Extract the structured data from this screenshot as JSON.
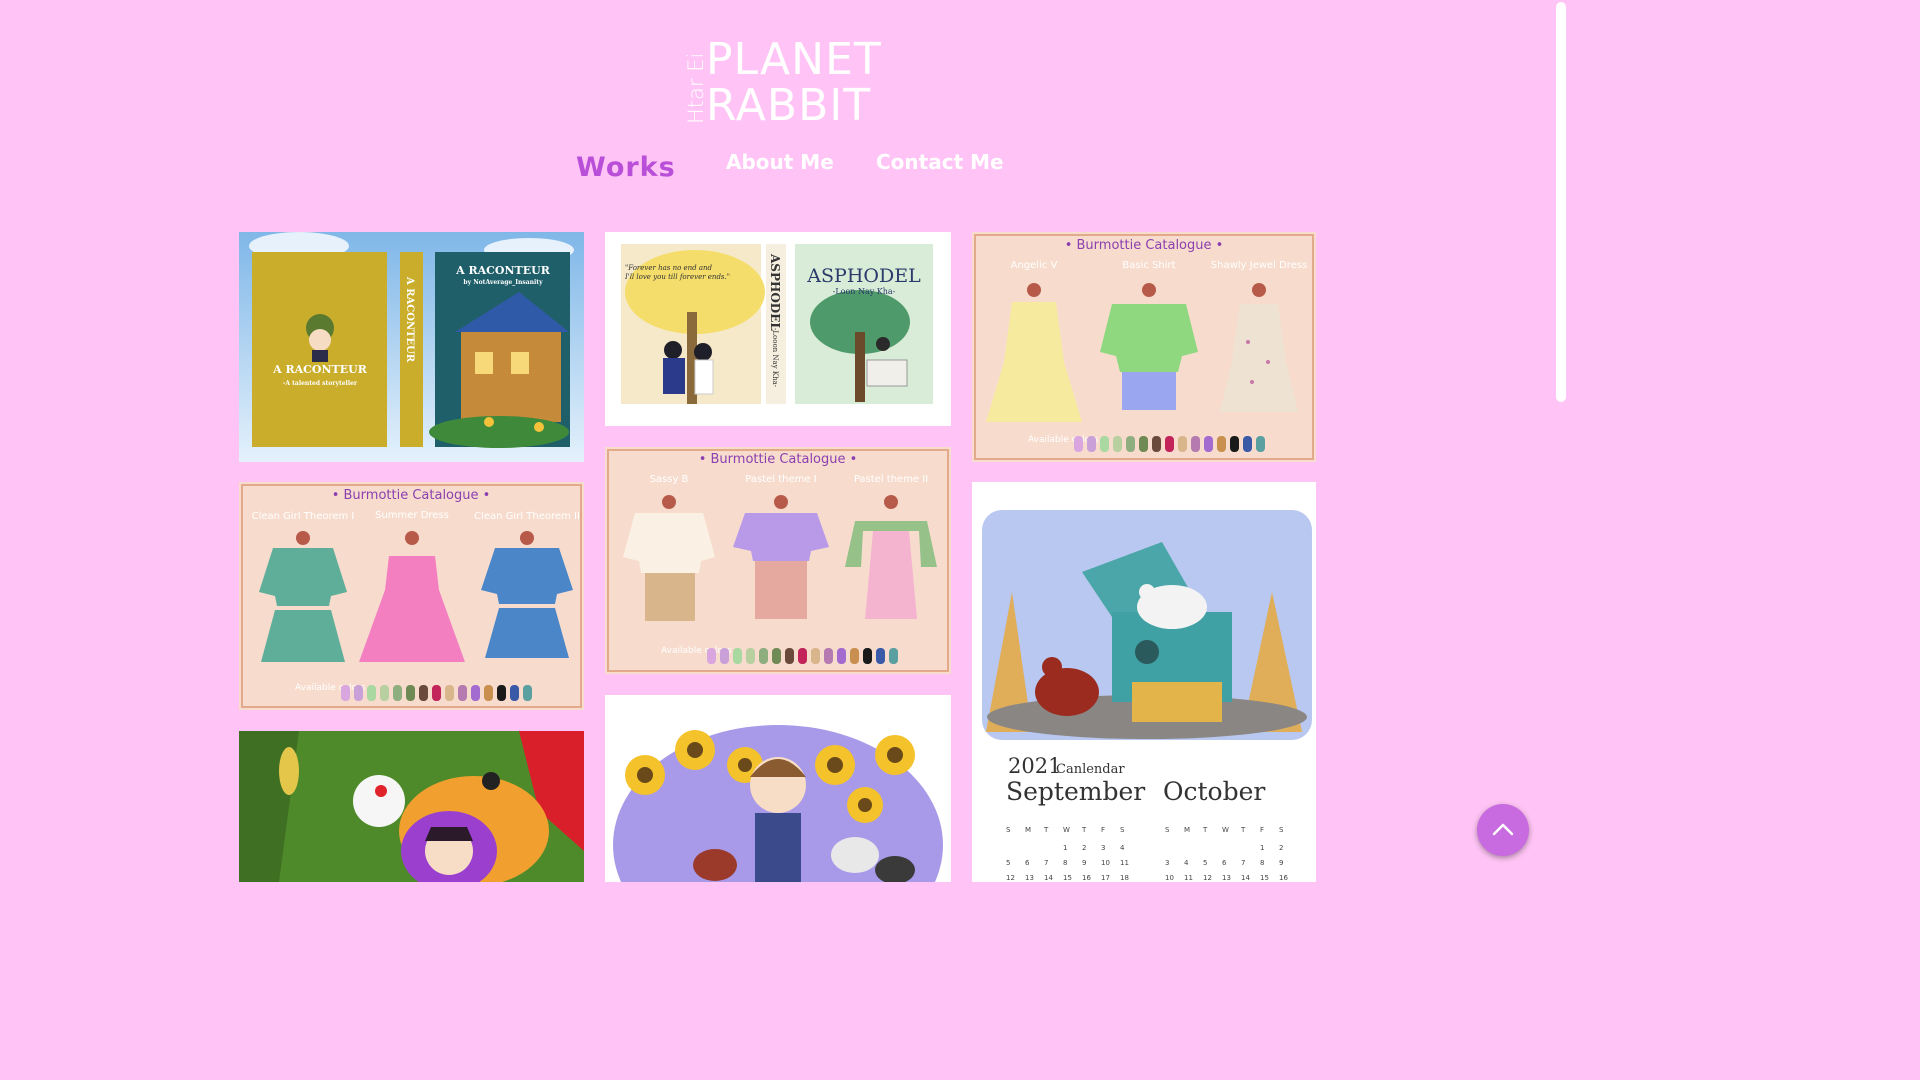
{
  "logo": {
    "side_text": "Htar Ei",
    "line1": "PLANET",
    "line2": "RABBIT"
  },
  "nav": {
    "works": "Works",
    "about": "About Me",
    "contact": "Contact Me"
  },
  "gallery": {
    "raconteur": {
      "front_title": "A RACONTEUR",
      "front_sub": "-A talented storyteller",
      "spine": "A RACONTEUR",
      "back_title": "A RACONTEUR",
      "back_sub": "by NotAverage_Insanity"
    },
    "asphodel": {
      "quote1": "\"Forever has no end and",
      "quote2": "I'll love you till forever ends.\"",
      "spine": "ASPHODEL",
      "spine_author": "-Looon Nay Kha-",
      "title": "ASPHODEL",
      "subtitle": "-Loon Nay Kha-"
    },
    "catalogue_1": {
      "title": "• Burmottie Catalogue •",
      "items": [
        "Angelic V",
        "Basic Shirt",
        "Shawly Jewel Dress"
      ],
      "available": "Available colors"
    },
    "catalogue_2": {
      "title": "• Burmottie Catalogue •",
      "items": [
        "Sassy B",
        "Pastel theme I",
        "Pastel theme II"
      ],
      "available": "Available colors"
    },
    "catalogue_3": {
      "title": "• Burmottie Catalogue •",
      "items": [
        "Clean Girl Theorem I",
        "Summer Dress",
        "Clean Girl Theorem II"
      ],
      "available": "Available colors"
    },
    "calendar": {
      "year": "2021",
      "word": "Canlendar",
      "month1": "September",
      "month2": "October",
      "weekdays": [
        "S",
        "M",
        "T",
        "W",
        "T",
        "F",
        "S"
      ],
      "sep_rows": [
        [
          "",
          "",
          "",
          "1",
          "2",
          "3",
          "4"
        ],
        [
          "5",
          "6",
          "7",
          "8",
          "9",
          "10",
          "11"
        ],
        [
          "12",
          "13",
          "14",
          "15",
          "16",
          "17",
          "18"
        ]
      ],
      "oct_rows": [
        [
          "",
          "",
          "",
          "",
          "",
          "1",
          "2"
        ],
        [
          "3",
          "4",
          "5",
          "6",
          "7",
          "8",
          "9"
        ],
        [
          "10",
          "11",
          "12",
          "13",
          "14",
          "15",
          "16"
        ]
      ]
    }
  },
  "colors": {
    "background": "#ffc4f5",
    "nav_active": "#b94fd9",
    "catalogue_bg": "#f7dccd",
    "catalogue_border": "#e3a98b",
    "to_top": "#c86ae0"
  },
  "swatches": [
    "#d9a6e0",
    "#c9a0d8",
    "#a9d8a0",
    "#b8cfa0",
    "#8fae7f",
    "#6f8a55",
    "#6a4a3a",
    "#c2245a",
    "#d8b58a",
    "#b57ab0",
    "#a36ad0",
    "#c88f4f",
    "#1a1a1a",
    "#3a5aa8",
    "#5aa0a0"
  ]
}
